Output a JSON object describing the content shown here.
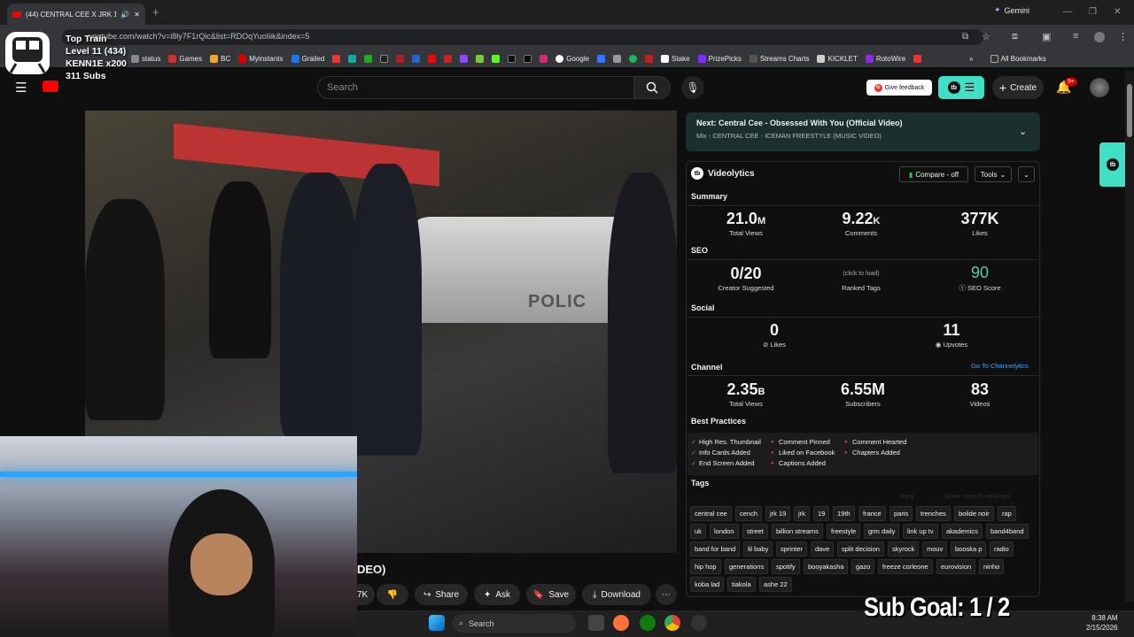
{
  "browser": {
    "tab_title": "(44) CENTRAL CEE X JRK 19",
    "new_tab": "+",
    "gemini_label": "Gemini",
    "url": "youtube.com/watch?v=i8ly7F1rQic&list=RDOqYuoIiik&index=5",
    "bookmarks": [
      "status",
      "Games",
      "BC",
      "Myinstants",
      "Grailed",
      "",
      "",
      "",
      "",
      "",
      "",
      "",
      "",
      "",
      "",
      "",
      "",
      "",
      "Google",
      "",
      "",
      "",
      "",
      "Stake",
      "PrizePicks",
      "Streams Charts",
      "KICKLET",
      "RotoWire",
      ""
    ],
    "all_bookmarks": "All Bookmarks"
  },
  "overlay": {
    "line1": "Top Train",
    "line2": "Level 11  (434)",
    "line3": "KENN1E x200",
    "line4": "311 Subs"
  },
  "youtube": {
    "search_placeholder": "Search",
    "give_feedback": "Give feedback",
    "create_label": "Create",
    "notif_count": "9+",
    "title_fragment": "DEO)",
    "like_fragment": "7K",
    "share": "Share",
    "ask": "Ask",
    "save": "Save",
    "download": "Download"
  },
  "next": {
    "title": "Next: Central Cee - Obsessed With You (Official Video)",
    "subtitle": "Mix - CENTRAL CEE - ICEMAN FREESTYLE (MUSIC VIDEO)"
  },
  "videolytics": {
    "name": "Videolytics",
    "compare": "Compare - off",
    "tools": "Tools",
    "summary_label": "Summary",
    "total_views": "21.0",
    "total_views_unit": "M",
    "total_views_label": "Total Views",
    "comments": "9.22",
    "comments_unit": "K",
    "comments_label": "Comments",
    "likes": "377K",
    "likes_label": "Likes",
    "seo_label": "SEO",
    "creator_suggested": "0/20",
    "creator_suggested_label": "Creator Suggested",
    "ranked_tags_hint": "(click to load)",
    "ranked_tags_label": "Ranked Tags",
    "seo_score": "90",
    "seo_score_label": "SEO Score",
    "social_label": "Social",
    "social_likes": "0",
    "social_likes_label": "Likes",
    "upvotes": "11",
    "upvotes_label": "Upvotes",
    "channel_label": "Channel",
    "channel_link": "Go To Channelytics",
    "channel_views": "2.35",
    "channel_views_unit": "B",
    "channel_views_label": "Total Views",
    "subscribers": "6.55M",
    "subscribers_label": "Subscribers",
    "videos": "83",
    "videos_label": "Videos",
    "best_practices_label": "Best Practices",
    "best_practices": [
      {
        "label": "High Res. Thumbnail",
        "ok": true
      },
      {
        "label": "Comment Pinned",
        "ok": false
      },
      {
        "label": "Comment Hearted",
        "ok": false
      },
      {
        "label": "Info Cards Added",
        "ok": true
      },
      {
        "label": "Liked on Facebook",
        "ok": false
      },
      {
        "label": "Chapters Added",
        "ok": false
      },
      {
        "label": "End Screen Added",
        "ok": true
      },
      {
        "label": "Captions Added",
        "ok": false
      }
    ],
    "tags_label": "Tags",
    "copy_label": "copy",
    "show_rankings": "Show search rankings",
    "tags": [
      "central cee",
      "cench",
      "jrk 19",
      "jrk",
      "19",
      "19th",
      "france",
      "paris",
      "trenches",
      "bolide noir",
      "rap",
      "uk",
      "london",
      "street",
      "billion streams",
      "freestyle",
      "grm daily",
      "link up tv",
      "akademics",
      "band4band",
      "band for band",
      "lil baby",
      "sprinter",
      "dave",
      "split decision",
      "skyrock",
      "mouv",
      "booska p",
      "radio",
      "hip hop",
      "generations",
      "spotify",
      "booyakasha",
      "gazo",
      "freeze corleone",
      "eurovision",
      "ninho",
      "koba lad",
      "tiakola",
      "ashe 22"
    ]
  },
  "stream": {
    "sub_goal": "Sub Goal:  1 / 2"
  },
  "taskbar": {
    "search": "Search",
    "time": "8:38 AM",
    "date": "2/15/2026"
  }
}
